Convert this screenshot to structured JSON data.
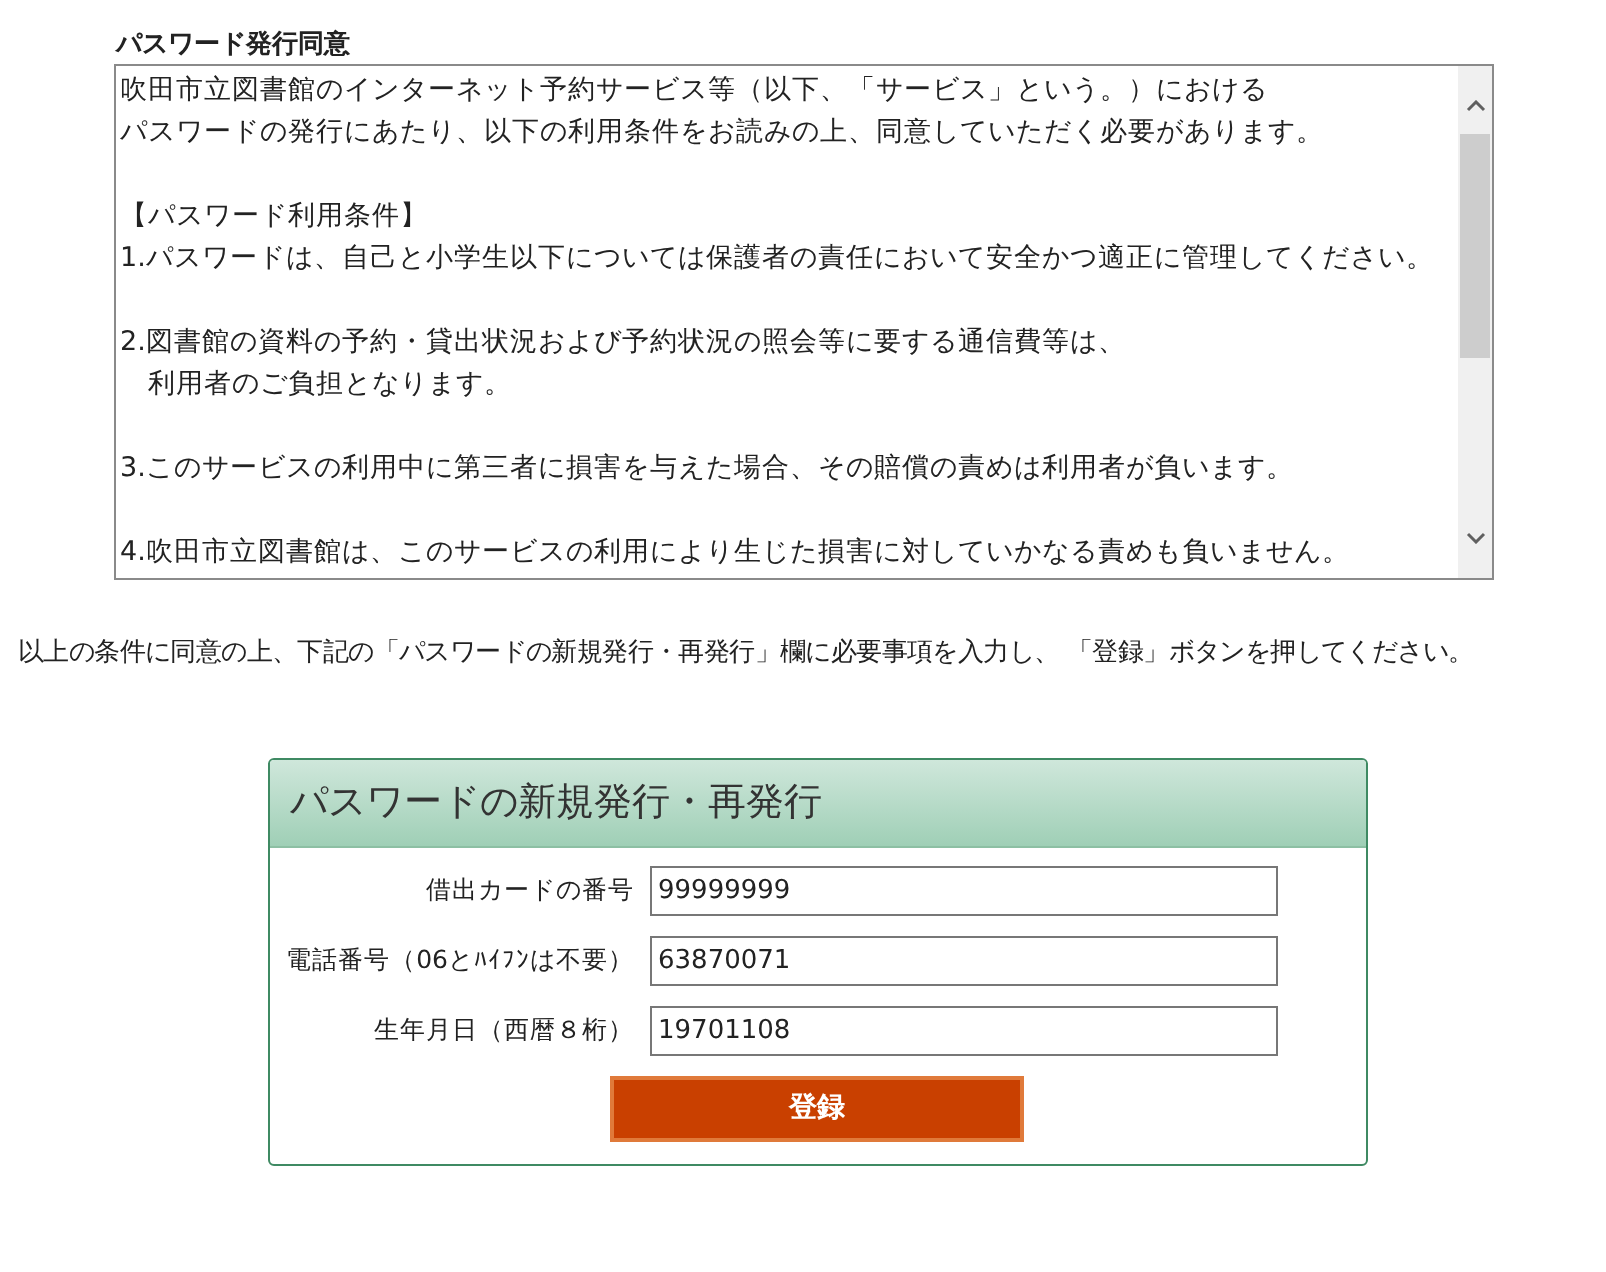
{
  "consent": {
    "title": "パスワード発行同意",
    "paragraphs": [
      {
        "lines": [
          "吹田市立図書館のインターネット予約サービス等（以下、「サービス」という。）における",
          "パスワードの発行にあたり、以下の利用条件をお読みの上、同意していただく必要があります。"
        ]
      },
      {
        "lines": [
          "【パスワード利用条件】",
          "1.パスワードは、自己と小学生以下については保護者の責任において安全かつ適正に管理してください。"
        ]
      },
      {
        "lines": [
          "2.図書館の資料の予約・貸出状況および予約状況の照会等に要する通信費等は、",
          "　利用者のご負担となります。"
        ]
      },
      {
        "lines": [
          "3.このサービスの利用中に第三者に損害を与えた場合、その賠償の責めは利用者が負います。"
        ]
      },
      {
        "lines": [
          "4.吹田市立図書館は、このサービスの利用により生じた損害に対していかなる責めも負いません。"
        ]
      }
    ]
  },
  "instruction": "以上の条件に同意の上、下記の「パスワードの新規発行・再発行」欄に必要事項を入力し、 「登録」ボタンを押してください。",
  "form": {
    "title": "パスワードの新規発行・再発行",
    "fields": [
      {
        "label": "借出カードの番号",
        "value": "99999999"
      },
      {
        "label": "電話番号（06とﾊｲﾌﾝは不要）",
        "value": "63870071"
      },
      {
        "label": "生年月日（西暦８桁）",
        "value": "19701108"
      }
    ],
    "submit": "登録"
  }
}
